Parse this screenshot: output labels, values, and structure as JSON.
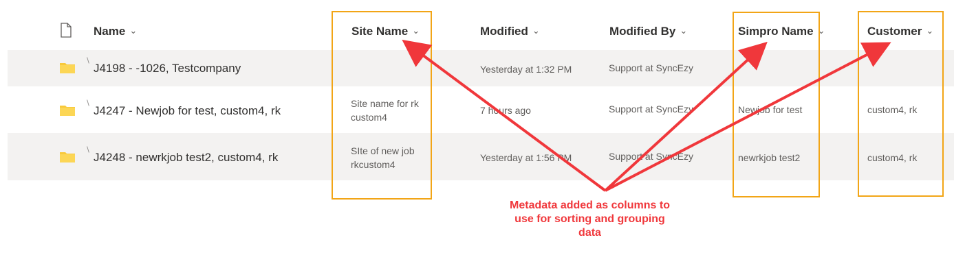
{
  "columns": {
    "name": "Name",
    "site_name": "Site Name",
    "modified": "Modified",
    "modified_by": "Modified By",
    "simpro_name": "Simpro Name",
    "customer": "Customer"
  },
  "rows": [
    {
      "name": "J4198 - -1026, Testcompany",
      "site_name_line1": "",
      "site_name_line2": "",
      "modified": "Yesterday at 1:32 PM",
      "modified_by": "Support at SyncEzy",
      "simpro_name": "",
      "customer": ""
    },
    {
      "name": "J4247 - Newjob for test, custom4, rk",
      "site_name_line1": "Site name for rk",
      "site_name_line2": "custom4",
      "modified": "7 hours ago",
      "modified_by": "Support at SyncEzy",
      "simpro_name": "Newjob for test",
      "customer": "custom4, rk"
    },
    {
      "name": "J4248 - newrkjob test2, custom4, rk",
      "site_name_line1": "SIte of new job",
      "site_name_line2": "rkcustom4",
      "modified": "Yesterday at 1:56 PM",
      "modified_by": "Support at SyncEzy",
      "simpro_name": "newrkjob test2",
      "customer": "custom4, rk"
    }
  ],
  "annotation": {
    "line1": "Metadata added as columns to",
    "line2": "use for sorting and grouping",
    "line3": "data"
  },
  "colors": {
    "highlight_box": "#f2a516",
    "arrow": "#f0373b",
    "folder": "#f8c93b",
    "row_shade": "#f3f2f1"
  },
  "icons": {
    "file_type": "document-icon",
    "folder": "folder-icon",
    "sort": "chevron-down-icon"
  }
}
